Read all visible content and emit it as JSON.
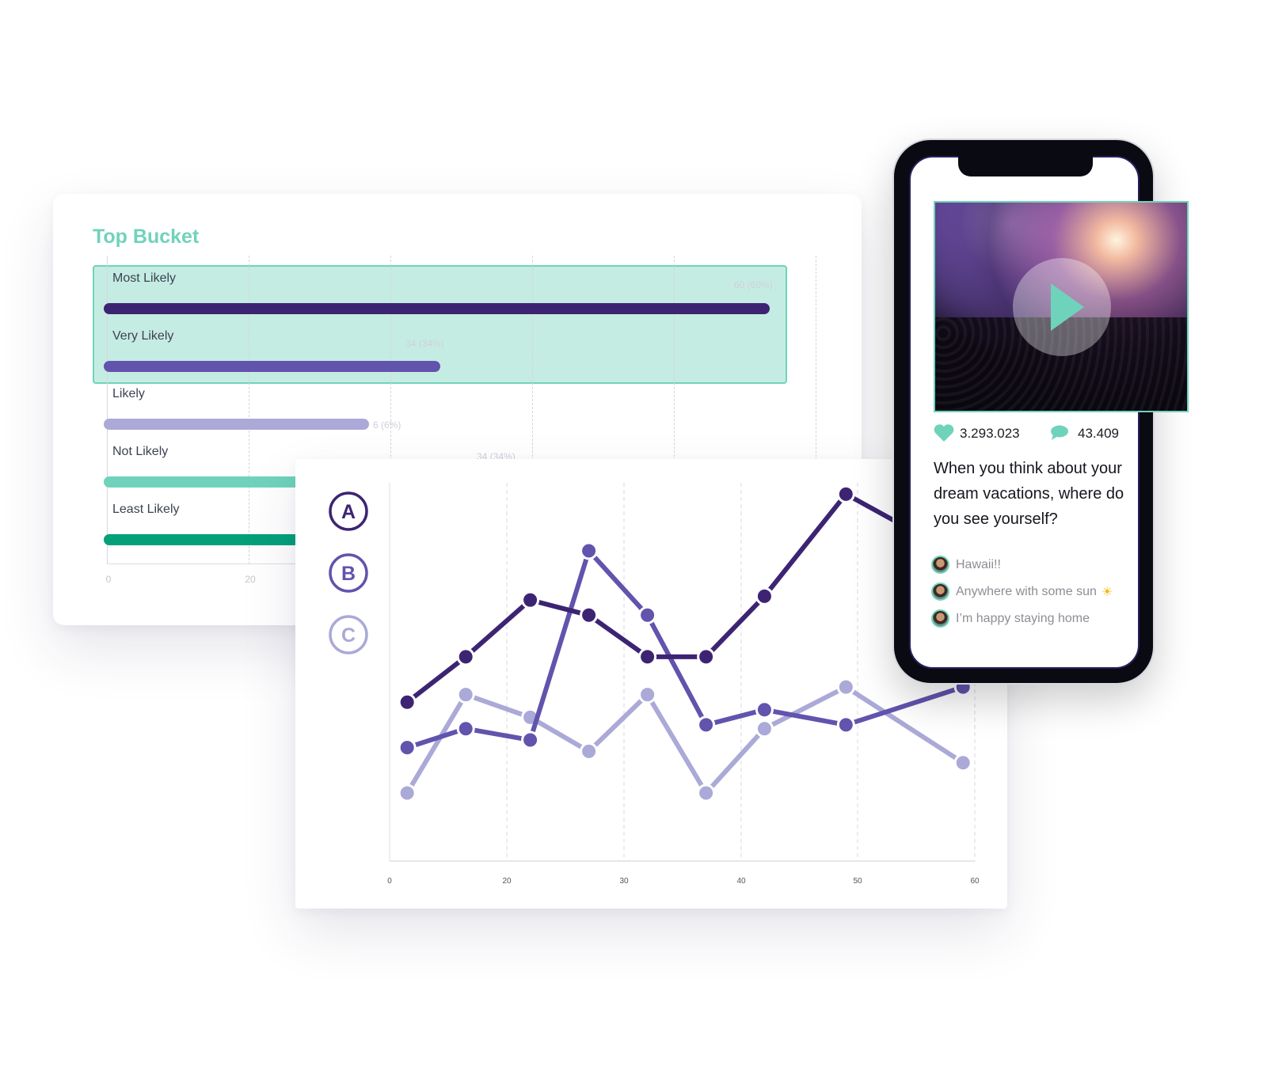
{
  "bar_chart": {
    "title": "Top Bucket",
    "axis_ticks": [
      "0",
      "20"
    ],
    "highlight_color": "#c5ece3",
    "rows": [
      {
        "label": "Most Likely",
        "value_label": "60 (60%)",
        "value": 93.5,
        "color": "#3d2473"
      },
      {
        "label": "Very Likely",
        "value_label": "34 (34%)",
        "value": 47,
        "color": "#6253ad"
      },
      {
        "label": "Likely",
        "value_label": "6 (6%)",
        "value": 37,
        "color": "#aaa9d8"
      },
      {
        "label": "Not Likely",
        "value_label": "34 (34%)",
        "value": 50,
        "color": "#6fd3bb"
      },
      {
        "label": "Least Likely",
        "value_label": "",
        "value": 40,
        "color": "#03a07a"
      }
    ]
  },
  "chart_data": {
    "type": "line",
    "x_ticks": [
      "0",
      "20",
      "30",
      "40",
      "50",
      "60"
    ],
    "grid": "vertical-dashed",
    "ylim": [
      0,
      100
    ],
    "legend": "left",
    "x": [
      3,
      13,
      22,
      27,
      32,
      37,
      42,
      49,
      59
    ],
    "series": [
      {
        "name": "A",
        "color": "#3d2473",
        "values": [
          42,
          54,
          69,
          65,
          54,
          54,
          70,
          97,
          80
        ]
      },
      {
        "name": "B",
        "color": "#6253ad",
        "values": [
          30,
          35,
          32,
          82,
          65,
          36,
          40,
          36,
          46
        ]
      },
      {
        "name": "C",
        "color": "#aaa9d8",
        "values": [
          18,
          44,
          38,
          29,
          44,
          18,
          35,
          46,
          26
        ]
      }
    ]
  },
  "phone": {
    "likes": "3.293.023",
    "comments": "43.409",
    "accent": "#6fd3bb",
    "question": "When you think about your dream vacations, where do you see yourself?",
    "answers": [
      "Hawaii!!",
      "Anywhere with some sun",
      "I’m happy staying home"
    ],
    "sun_emoji": "☀"
  }
}
